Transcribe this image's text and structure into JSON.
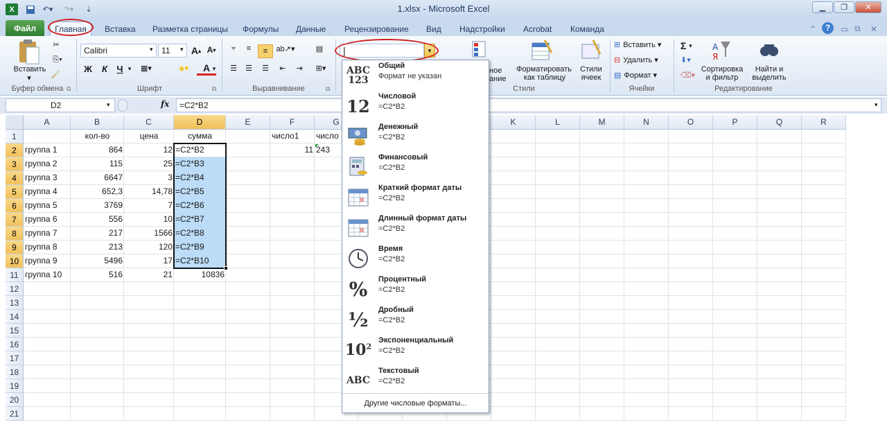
{
  "title": "1.xlsx  -  Microsoft Excel",
  "tabs": [
    "Файл",
    "Главная",
    "Вставка",
    "Разметка страницы",
    "Формулы",
    "Данные",
    "Рецензирование",
    "Вид",
    "Надстройки",
    "Acrobat",
    "Команда"
  ],
  "ribbon": {
    "clipboard": {
      "paste": "Вставить",
      "label": "Буфер обмена"
    },
    "font": {
      "name": "Calibri",
      "size": "11",
      "label": "Шрифт",
      "bold": "Ж",
      "italic": "К",
      "underline": "Ч"
    },
    "alignment": {
      "label": "Выравнивание"
    },
    "number": {
      "format": "|"
    },
    "styles": {
      "format_table": "Форматировать",
      "format_table2": "как таблицу",
      "cell_styles": "Стили",
      "cell_styles2": "ячеек",
      "partial_top": "ное",
      "partial_bottom": "ание",
      "label": "Стили"
    },
    "cells": {
      "insert": "Вставить",
      "delete": "Удалить",
      "format": "Формат",
      "label": "Ячейки"
    },
    "editing": {
      "sort": "Сортировка",
      "sort2": "и фильтр",
      "find": "Найти и",
      "find2": "выделить",
      "label": "Редактирование",
      "sigma": "Σ"
    }
  },
  "formula_bar": {
    "namebox": "D2",
    "fx": "fx",
    "formula": "=C2*B2"
  },
  "columns": [
    "A",
    "B",
    "C",
    "D",
    "E",
    "F",
    "G",
    "H",
    "I",
    "J",
    "K",
    "L",
    "M",
    "N",
    "O",
    "P",
    "Q",
    "R"
  ],
  "rows": [
    "1",
    "2",
    "3",
    "4",
    "5",
    "6",
    "7",
    "8",
    "9",
    "10",
    "11",
    "12",
    "13",
    "14",
    "15",
    "16",
    "17",
    "18",
    "19",
    "20",
    "21"
  ],
  "headers": {
    "b": "кол-во",
    "c": "цена",
    "d": "сумма",
    "f": "число1",
    "g": "число"
  },
  "data": [
    [
      "группа 1",
      "864",
      "12",
      "=C2*B2"
    ],
    [
      "группа 2",
      "115",
      "25",
      "=C2*B3"
    ],
    [
      "группа 3",
      "6647",
      "3",
      "=C2*B4"
    ],
    [
      "группа 4",
      "652,3",
      "14,78",
      "=C2*B5"
    ],
    [
      "группа 5",
      "3769",
      "7",
      "=C2*B6"
    ],
    [
      "группа 6",
      "556",
      "10",
      "=C2*B7"
    ],
    [
      "группа 7",
      "217",
      "1566",
      "=C2*B8"
    ],
    [
      "группа 8",
      "213",
      "120",
      "=C2*B9"
    ],
    [
      "группа 9",
      "5496",
      "17",
      "=C2*B10"
    ],
    [
      "группа 10",
      "516",
      "21",
      "10836"
    ]
  ],
  "f2": "11",
  "g2": "243",
  "dropdown": {
    "items": [
      {
        "label": "Общий",
        "sub": "Формат не указан",
        "icon": "ABC\n123"
      },
      {
        "label": "Числовой",
        "sub": "=C2*B2",
        "icon": "12"
      },
      {
        "label": "Денежный",
        "sub": "=C2*B2",
        "icon": "money"
      },
      {
        "label": "Финансовый",
        "sub": " =C2*B2",
        "icon": "calc"
      },
      {
        "label": "Краткий формат даты",
        "sub": "=C2*B2",
        "icon": "cal"
      },
      {
        "label": "Длинный формат даты",
        "sub": "=C2*B2",
        "icon": "cal"
      },
      {
        "label": "Время",
        "sub": "=C2*B2",
        "icon": "clock"
      },
      {
        "label": "Процентный",
        "sub": "=C2*B2",
        "icon": "%"
      },
      {
        "label": "Дробный",
        "sub": "=C2*B2",
        "icon": "½"
      },
      {
        "label": "Экспоненциальный",
        "sub": "=C2*B2",
        "icon": "10²"
      },
      {
        "label": "Текстовый",
        "sub": "=C2*B2",
        "icon": "ABC"
      }
    ],
    "more": "Другие числовые форматы..."
  },
  "colors": {
    "accent": "#c9d9ee",
    "selection": "#bcdcf7",
    "file_tab": "#2e7d32",
    "annotation": "#d02020"
  }
}
